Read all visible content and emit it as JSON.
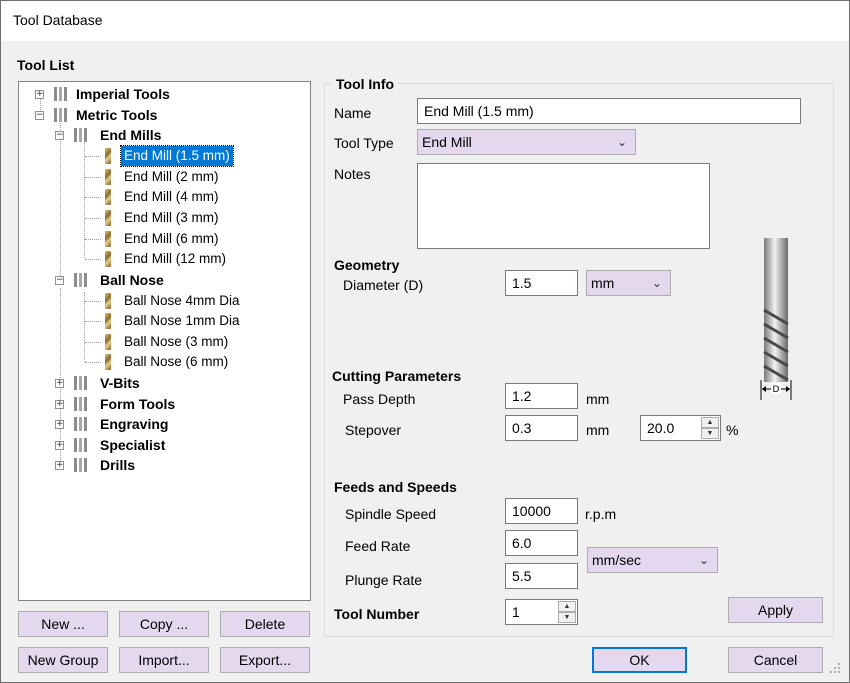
{
  "window": {
    "title": "Tool Database"
  },
  "tree": {
    "heading": "Tool List",
    "imperial": "Imperial Tools",
    "metric": "Metric Tools",
    "end_mills": "End Mills",
    "end_mill_items": [
      "End Mill (1.5 mm)",
      "End Mill (2 mm)",
      "End Mill (4 mm)",
      "End Mill (3 mm)",
      "End Mill (6 mm)",
      "End Mill (12 mm)"
    ],
    "ball_nose": "Ball Nose",
    "ball_nose_items": [
      "Ball Nose  4mm Dia",
      "Ball Nose  1mm Dia",
      "Ball Nose  (3 mm)",
      "Ball Nose  (6 mm)"
    ],
    "groups": [
      "V-Bits",
      "Form Tools",
      "Engraving",
      "Specialist",
      "Drills"
    ],
    "expander_plus": "+",
    "expander_minus": "−"
  },
  "buttons": {
    "new": "New ...",
    "copy": "Copy ...",
    "delete": "Delete",
    "new_group": "New Group",
    "import": "Import...",
    "export": "Export...",
    "apply": "Apply",
    "ok": "OK",
    "cancel": "Cancel"
  },
  "info": {
    "heading": "Tool Info",
    "name_label": "Name",
    "name_value": "End Mill (1.5 mm)",
    "type_label": "Tool Type",
    "type_value": "End Mill",
    "notes_label": "Notes",
    "notes_value": ""
  },
  "geometry": {
    "heading": "Geometry",
    "diameter_label": "Diameter (D)",
    "diameter_value": "1.5",
    "units_value": "mm",
    "diagram_label": "D"
  },
  "cutting": {
    "heading": "Cutting Parameters",
    "pass_depth_label": "Pass Depth",
    "pass_depth_value": "1.2",
    "pass_depth_unit": "mm",
    "stepover_label": "Stepover",
    "stepover_value": "0.3",
    "stepover_unit": "mm",
    "stepover_pct_value": "20.0",
    "stepover_pct_unit": "%"
  },
  "feeds": {
    "heading": "Feeds and Speeds",
    "spindle_label": "Spindle Speed",
    "spindle_value": "10000",
    "spindle_unit": "r.p.m",
    "feed_label": "Feed Rate",
    "feed_value": "6.0",
    "plunge_label": "Plunge Rate",
    "plunge_value": "5.5",
    "rate_units_value": "mm/sec"
  },
  "tool_number": {
    "label": "Tool Number",
    "value": "1"
  },
  "colors": {
    "selection": "#0078d7",
    "button_face": "#e3d8ee",
    "window_bg": "#f0f0f0"
  },
  "icons": [
    "folder-icon",
    "end-mill-tool-icon",
    "ball-nose-tool-icon",
    "chevron-down-icon",
    "spin-up-icon",
    "spin-down-icon",
    "resize-grip-icon"
  ]
}
